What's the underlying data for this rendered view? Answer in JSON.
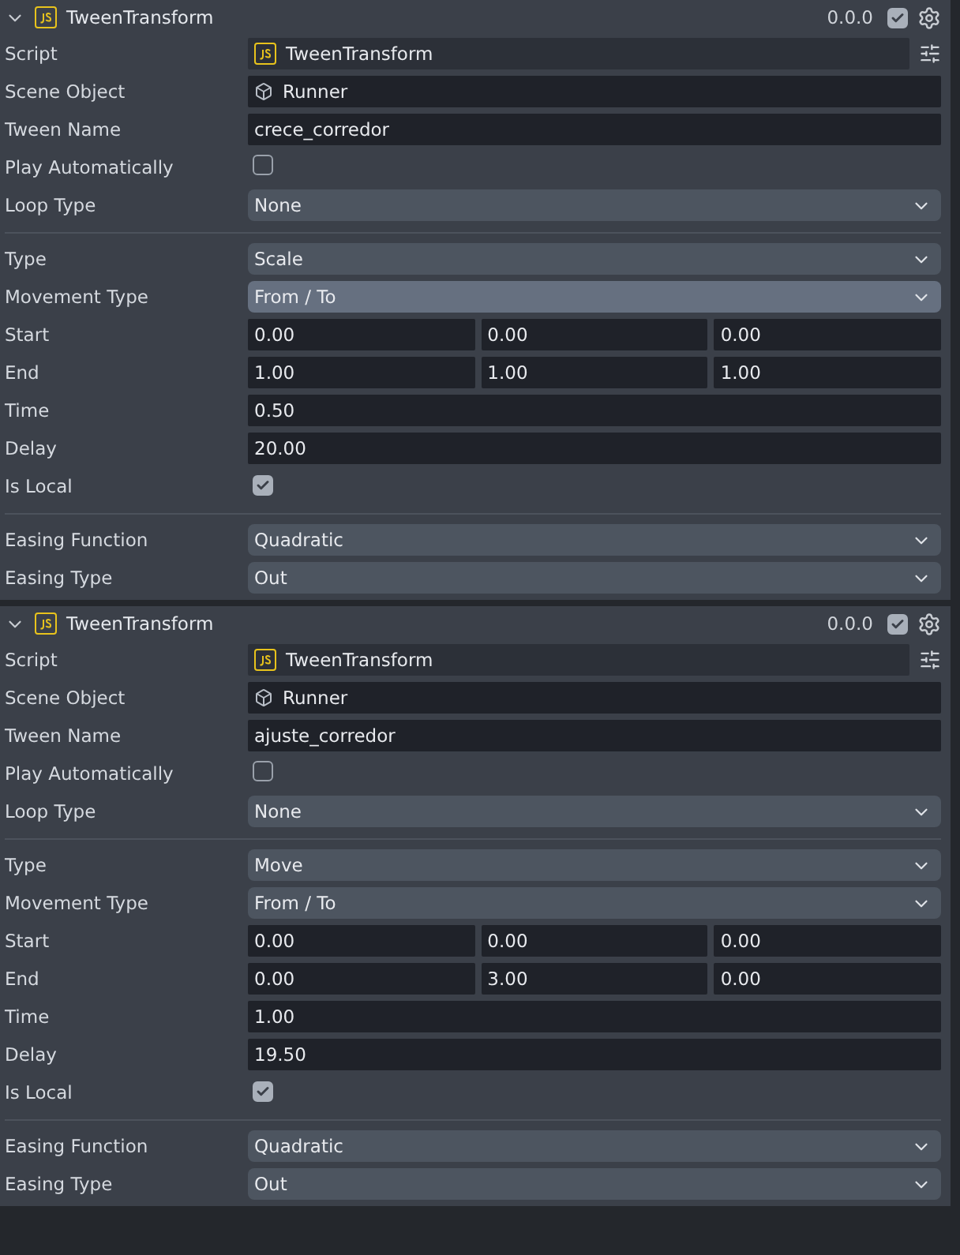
{
  "components": [
    {
      "title": "TweenTransform",
      "version": "0.0.0",
      "enabled": true,
      "expanded": true,
      "sections": [
        [
          {
            "kind": "script",
            "label": "Script",
            "value": "TweenTransform"
          },
          {
            "kind": "object",
            "label": "Scene Object",
            "value": "Runner"
          },
          {
            "kind": "text",
            "label": "Tween Name",
            "value": "crece_corredor"
          },
          {
            "kind": "checkbox",
            "label": "Play Automatically",
            "checked": false
          },
          {
            "kind": "dropdown",
            "label": "Loop Type",
            "value": "None",
            "highlighted": false
          }
        ],
        [
          {
            "kind": "dropdown",
            "label": "Type",
            "value": "Scale",
            "highlighted": false
          },
          {
            "kind": "dropdown",
            "label": "Movement Type",
            "value": "From / To",
            "highlighted": true
          },
          {
            "kind": "vector",
            "label": "Start",
            "values": [
              "0.00",
              "0.00",
              "0.00"
            ]
          },
          {
            "kind": "vector",
            "label": "End",
            "values": [
              "1.00",
              "1.00",
              "1.00"
            ]
          },
          {
            "kind": "text",
            "label": "Time",
            "value": "0.50"
          },
          {
            "kind": "text",
            "label": "Delay",
            "value": "20.00"
          },
          {
            "kind": "checkbox",
            "label": "Is Local",
            "checked": true
          }
        ],
        [
          {
            "kind": "dropdown",
            "label": "Easing Function",
            "value": "Quadratic",
            "highlighted": false
          },
          {
            "kind": "dropdown",
            "label": "Easing Type",
            "value": "Out",
            "highlighted": false
          }
        ]
      ]
    },
    {
      "title": "TweenTransform",
      "version": "0.0.0",
      "enabled": true,
      "expanded": true,
      "sections": [
        [
          {
            "kind": "script",
            "label": "Script",
            "value": "TweenTransform"
          },
          {
            "kind": "object",
            "label": "Scene Object",
            "value": "Runner"
          },
          {
            "kind": "text",
            "label": "Tween Name",
            "value": "ajuste_corredor"
          },
          {
            "kind": "checkbox",
            "label": "Play Automatically",
            "checked": false
          },
          {
            "kind": "dropdown",
            "label": "Loop Type",
            "value": "None",
            "highlighted": false
          }
        ],
        [
          {
            "kind": "dropdown",
            "label": "Type",
            "value": "Move",
            "highlighted": false
          },
          {
            "kind": "dropdown",
            "label": "Movement Type",
            "value": "From / To",
            "highlighted": false
          },
          {
            "kind": "vector",
            "label": "Start",
            "values": [
              "0.00",
              "0.00",
              "0.00"
            ]
          },
          {
            "kind": "vector",
            "label": "End",
            "values": [
              "0.00",
              "3.00",
              "0.00"
            ]
          },
          {
            "kind": "text",
            "label": "Time",
            "value": "1.00"
          },
          {
            "kind": "text",
            "label": "Delay",
            "value": "19.50"
          },
          {
            "kind": "checkbox",
            "label": "Is Local",
            "checked": true
          }
        ],
        [
          {
            "kind": "dropdown",
            "label": "Easing Function",
            "value": "Quadratic",
            "highlighted": false
          },
          {
            "kind": "dropdown",
            "label": "Easing Type",
            "value": "Out",
            "highlighted": false
          }
        ]
      ]
    }
  ]
}
